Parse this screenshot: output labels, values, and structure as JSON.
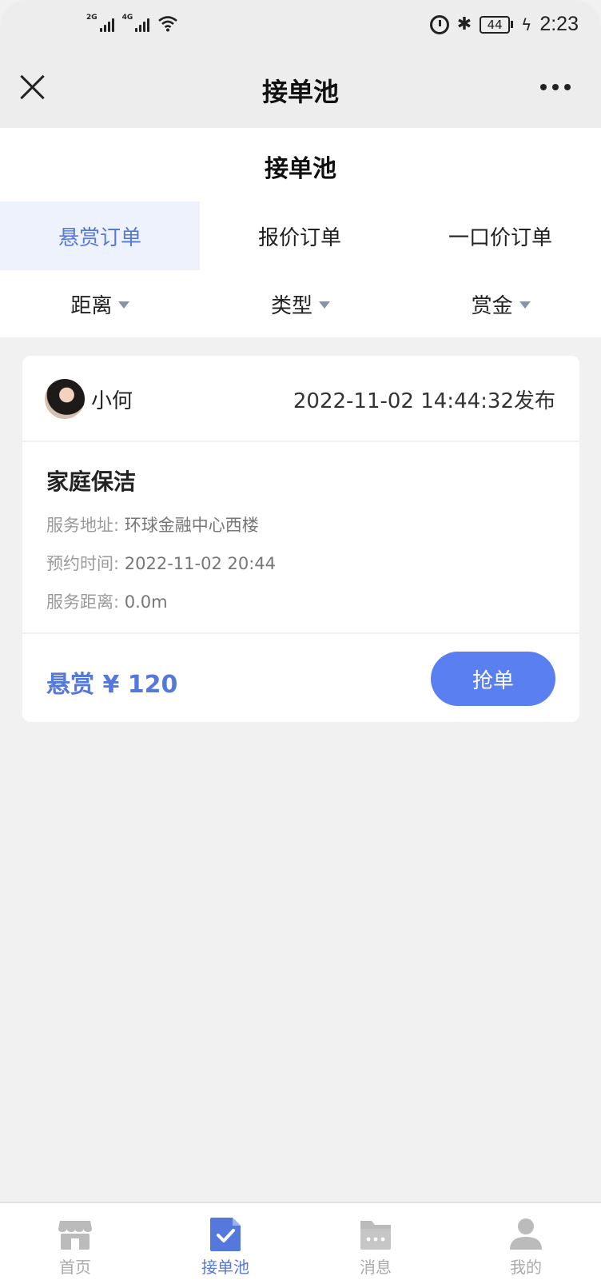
{
  "status_bar": {
    "sim1": "2G",
    "sim2": "4G",
    "battery": "44",
    "time": "2:23"
  },
  "nav": {
    "title": "接单池"
  },
  "page": {
    "title": "接单池"
  },
  "tabs": [
    {
      "label": "悬赏订单",
      "active": true
    },
    {
      "label": "报价订单",
      "active": false
    },
    {
      "label": "一口价订单",
      "active": false
    }
  ],
  "filters": [
    {
      "label": "距离"
    },
    {
      "label": "类型"
    },
    {
      "label": "赏金"
    }
  ],
  "orders": [
    {
      "user": "小何",
      "published": "2022-11-02 14:44:32发布",
      "service": "家庭保洁",
      "address_label": "服务地址:",
      "address": "环球金融中心西楼",
      "time_label": "预约时间:",
      "time": "2022-11-02 20:44",
      "distance_label": "服务距离:",
      "distance": "0.0m",
      "reward": "悬赏 ¥ 120",
      "action": "抢单"
    }
  ],
  "tabbar": [
    {
      "label": "首页",
      "icon": "store-icon",
      "active": false
    },
    {
      "label": "接单池",
      "icon": "order-check-icon",
      "active": true
    },
    {
      "label": "消息",
      "icon": "message-icon",
      "active": false
    },
    {
      "label": "我的",
      "icon": "user-icon",
      "active": false
    }
  ],
  "colors": {
    "accent": "#5578dd",
    "button": "#5a7ff0",
    "tab_active_bg": "#edf2fd",
    "inactive_icon": "#bbbbbb"
  }
}
